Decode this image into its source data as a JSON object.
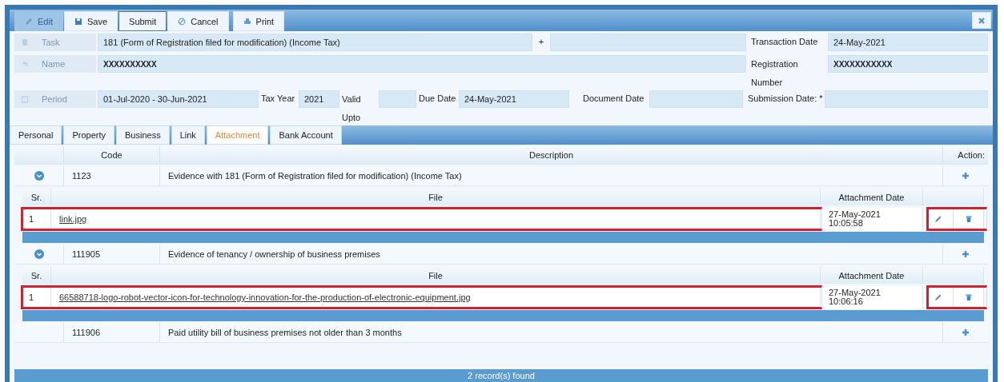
{
  "toolbar": [
    {
      "label": "Edit",
      "kind": "pencil",
      "disabled": true
    },
    {
      "label": "Save",
      "kind": "disk",
      "disabled": false
    },
    {
      "label": "Submit",
      "kind": "plain",
      "disabled": false
    },
    {
      "label": "Cancel",
      "kind": "ban",
      "disabled": false
    },
    {
      "label": "Print",
      "kind": "printer",
      "disabled": false
    }
  ],
  "form": {
    "task": {
      "label": "Task",
      "value": "181 (Form of Registration filed for modification) (Income Tax)",
      "separator": "+"
    },
    "transaction_date": {
      "label": "Transaction Date",
      "value": "24-May-2021"
    },
    "name": {
      "label": "Name",
      "value": "XXXXXXXXXX"
    },
    "registration_number": {
      "label_lines": [
        "Registration",
        "Number"
      ],
      "value": "XXXXXXXXXXX"
    },
    "period": {
      "label": "Period",
      "value": "01-Jul-2020 -  30-Jun-2021"
    },
    "tax_year": {
      "label": "Tax Year",
      "value": "2021"
    },
    "valid_upto": {
      "label_lines": [
        "Valid",
        "Upto"
      ]
    },
    "due_date": {
      "label": "Due Date",
      "value": "24-May-2021"
    },
    "document_date": {
      "label": "Document Date"
    },
    "submission_date": {
      "label": "Submission Date: *"
    }
  },
  "tabs": [
    {
      "label": "Personal",
      "selected": false
    },
    {
      "label": "Property",
      "selected": false
    },
    {
      "label": "Business",
      "selected": false
    },
    {
      "label": "Link",
      "selected": false
    },
    {
      "label": "Attachment",
      "selected": true
    },
    {
      "label": "Bank Account",
      "selected": false
    }
  ],
  "table": {
    "columns": [
      "Code",
      "Description",
      "Action:"
    ],
    "rows": [
      {
        "code": "1123",
        "description": "Evidence with 181 (Form of Registration filed for modification) (Income Tax)",
        "file_columns": [
          "Sr.",
          "File",
          "Attachment Date"
        ],
        "files": [
          {
            "sr": "1",
            "file": "link.jpg",
            "date": "27-May-2021",
            "time": "10:05:58",
            "highlighted": true
          }
        ]
      },
      {
        "code": "111905",
        "description": "Evidence of tenancy / ownership of business premises",
        "file_columns": [
          "Sr.",
          "File",
          "Attachment Date"
        ],
        "files": [
          {
            "sr": "1",
            "file": "66588718-logo-robot-vector-icon-for-technology-innovation-for-the-production-of-electronic-equipment.jpg",
            "date": "27-May-2021",
            "time": "10:06:16",
            "highlighted": true
          }
        ]
      },
      {
        "code": "111906",
        "description": "Paid utility bill of business premises not older than 3 months",
        "file_columns": [],
        "files": []
      }
    ],
    "footer": "2 record(s) found"
  }
}
